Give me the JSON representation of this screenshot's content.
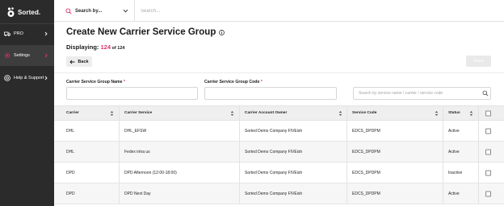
{
  "brand": {
    "name": "Sorted.",
    "accent": "#e0316e"
  },
  "sidebar": {
    "items": [
      {
        "label": "PRO",
        "icon": "truck-icon"
      },
      {
        "label": "Settings",
        "icon": "gear-icon"
      },
      {
        "label": "Help & Support",
        "icon": "help-icon"
      }
    ]
  },
  "topbar": {
    "scope_label": "Search by...",
    "search_placeholder": "Search..."
  },
  "page": {
    "title": "Create New Carrier Service Group",
    "displaying_label": "Displaying: ",
    "displaying_count": "124",
    "displaying_total": " of 124",
    "back_label": "Back",
    "save_label": "Save"
  },
  "form": {
    "group_name_label": "Carrier Service Group Name",
    "group_code_label": "Carrier Service Group Code",
    "required_mark": "*",
    "filter_placeholder": "Search by service name / carrier / service code"
  },
  "table": {
    "columns": [
      "Carrier",
      "Carrier Service",
      "Carrier Account Owner",
      "Service Code",
      "Status"
    ],
    "rows": [
      {
        "carrier": "DHL",
        "service": "DHL_EFSW",
        "owner": "Sorted Demo Company FIVEish",
        "code": "EDCS_DPDPM",
        "status": "Active"
      },
      {
        "carrier": "DHL",
        "service": "Fedex intra us",
        "owner": "Sorted Demo Company FIVEish",
        "code": "EDCS_DPDPM",
        "status": "Active"
      },
      {
        "carrier": "DPD",
        "service": "DPD Afternoon (12:00-18:00)",
        "owner": "Sorted Demo Company FIVEish",
        "code": "EDCS_DPDPM",
        "status": "Inactive"
      },
      {
        "carrier": "DPD",
        "service": "DPD Next Day",
        "owner": "Sorted Demo Company FIVEish",
        "code": "EDCS_DPDPM",
        "status": "Active"
      }
    ]
  }
}
